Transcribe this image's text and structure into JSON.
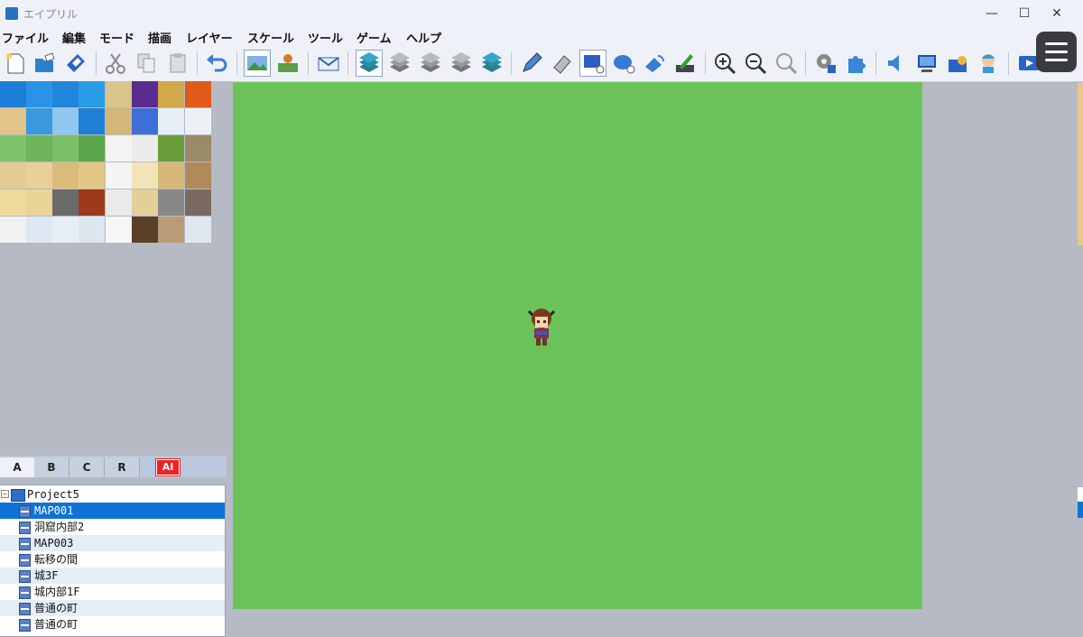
{
  "window": {
    "title": "エイプリル",
    "minimize": "—",
    "maximize": "☐",
    "close": "✕"
  },
  "menu": [
    "ファイル",
    "編集",
    "モード",
    "描画",
    "レイヤー",
    "スケール",
    "ツール",
    "ゲーム",
    "ヘルプ"
  ],
  "toolbar_icons": [
    "new-project-icon",
    "open-project-icon",
    "save-project-icon",
    "cut-icon",
    "copy-icon",
    "paste-icon",
    "undo-icon",
    "map-mode-icon",
    "event-mode-icon",
    "region-mode-icon",
    "layer-1-icon",
    "layer-2-icon",
    "layer-3-icon",
    "layer-4-icon",
    "layer-5-icon",
    "pencil-icon",
    "eraser-icon",
    "rectangle-icon",
    "ellipse-icon",
    "fill-icon",
    "shadow-pen-icon",
    "zoom-in-icon",
    "zoom-out-icon",
    "zoom-actual-icon",
    "database-icon",
    "plugin-icon",
    "sound-test-icon",
    "event-searcher-icon",
    "resource-manager-icon",
    "character-generator-icon",
    "playtest-icon"
  ],
  "tileset_tabs": [
    "A",
    "B",
    "C",
    "R"
  ],
  "ai_tab": "AI",
  "project": "Project5",
  "maps": [
    "MAP001",
    "洞窟内部2",
    "MAP003",
    "転移の間",
    "城3F",
    "城内部1F",
    "普通の町",
    "普通の町"
  ],
  "selected_map": "MAP001",
  "colors": {
    "grass": "#6cc25a",
    "selection": "#0f72d7",
    "panel": "#b5bac4"
  }
}
